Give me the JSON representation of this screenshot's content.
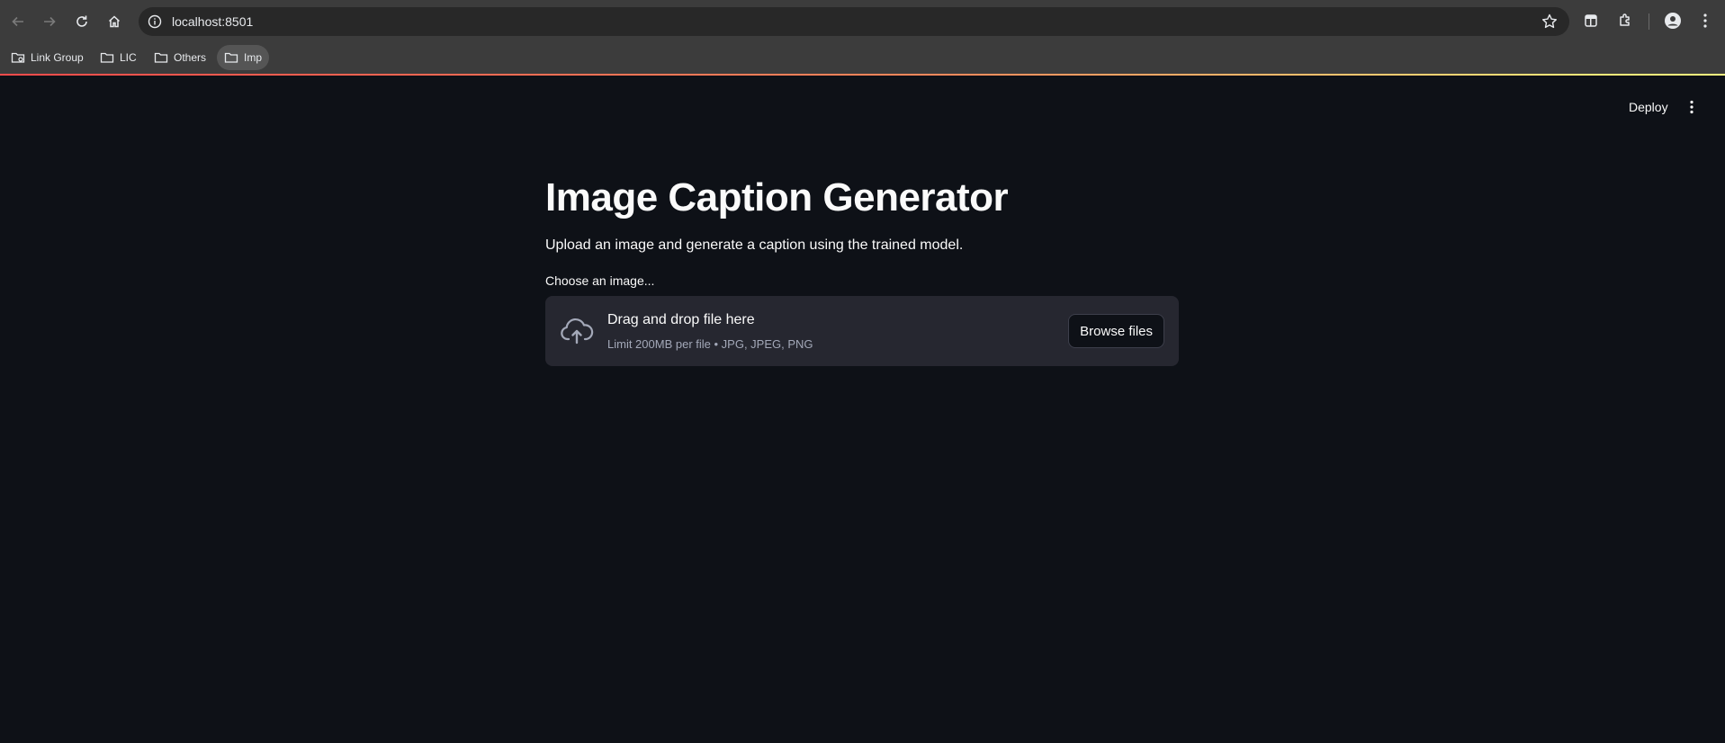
{
  "browser": {
    "url": "localhost:8501",
    "bookmarks": [
      {
        "label": "Link Group",
        "icon": "folder-gear-icon"
      },
      {
        "label": "LIC",
        "icon": "folder-icon"
      },
      {
        "label": "Others",
        "icon": "folder-icon"
      },
      {
        "label": "Imp",
        "icon": "folder-icon"
      }
    ]
  },
  "app": {
    "deploy_label": "Deploy",
    "title": "Image Caption Generator",
    "subtitle": "Upload an image and generate a caption using the trained model.",
    "uploader": {
      "label": "Choose an image...",
      "drop_text": "Drag and drop file here",
      "limit_text": "Limit 200MB per file • JPG, JPEG, PNG",
      "browse_label": "Browse files"
    }
  },
  "colors": {
    "background": "#0e1117",
    "dropzone": "#262730",
    "accent_start": "#ff4b4b",
    "accent_end": "#fffd80"
  }
}
